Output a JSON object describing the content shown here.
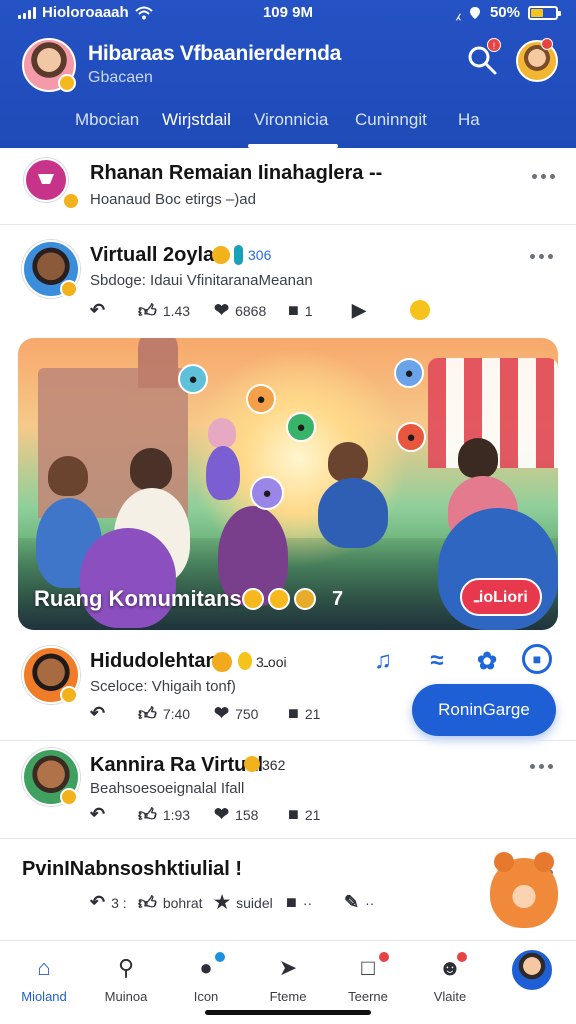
{
  "status_bar": {
    "carrier": "Hioloroaaah",
    "time": "109 9M",
    "battery": "50%"
  },
  "app_header": {
    "title": "Hibaraas Vfbaanierdernda",
    "subtitle": "Gbacaen",
    "notification_count": "!"
  },
  "tabs": [
    {
      "label": "Mbocian"
    },
    {
      "label": "Wirjstdail"
    },
    {
      "label": "Vironnicia"
    },
    {
      "label": "Cuninngit"
    },
    {
      "label": "Ha"
    }
  ],
  "group_post": {
    "title": "Rhanan Remaian Iinahaglera --",
    "subtitle": "Hoanaud Boc etirgs –)ad"
  },
  "post1": {
    "author": "Virtuall 2oyla",
    "meta": "306",
    "subtitle": "Sbdoge: Idaui VfinitaranaMeanan",
    "likes": "1.43",
    "comments": "6868",
    "shares": "1"
  },
  "featured": {
    "caption": "Ruang Komumitans",
    "count": "7",
    "button_label": "ـioLiori"
  },
  "quick_actions": {
    "cta_label": "RoninGarge"
  },
  "post2": {
    "author": "Hidudolehtan",
    "meta": "3ـooi",
    "subtitle": "Sceloce: Vhigaih tonf)",
    "likes": "7:40",
    "comments": "750",
    "shares": "21"
  },
  "post3": {
    "author": "Kannira Ra Virtual",
    "meta": "362",
    "subtitle": "Beahsoesoeignalal Ifall",
    "likes": "1:93",
    "comments": "158",
    "shares": "21"
  },
  "post4": {
    "title": "PvinINabnsoshktiulial !",
    "a1": "3 :",
    "a2": "bohrat",
    "a3": "suidel",
    "a4": "··",
    "a5": "··"
  },
  "bottom_nav": [
    {
      "label": "Mioland"
    },
    {
      "label": "Muinoa"
    },
    {
      "label": "Icon"
    },
    {
      "label": "Fteme"
    },
    {
      "label": "Teerne"
    },
    {
      "label": "Vlaite"
    }
  ],
  "colors": {
    "brand": "#2552c4",
    "accent": "#1f5fd6",
    "alert": "#e84343",
    "badge": "#f2b21c"
  },
  "icons": [
    "wifi-icon",
    "search-icon",
    "more-icon",
    "reply-icon",
    "thumbs-up-icon",
    "heart-icon",
    "chat-icon",
    "music-note-icon",
    "home-icon",
    "notification-icon"
  ]
}
